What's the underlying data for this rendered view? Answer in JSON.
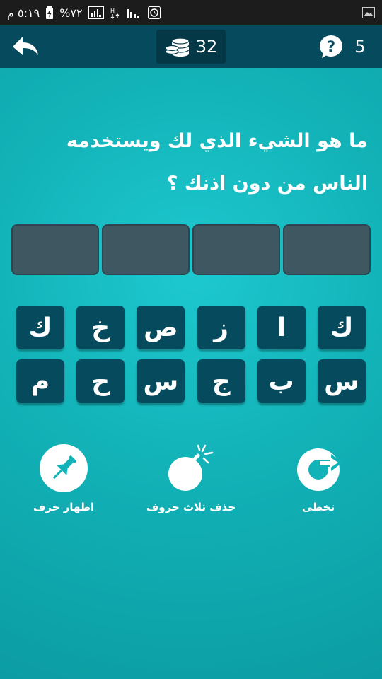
{
  "status_bar": {
    "time": "٥:١٩ م",
    "battery": "%٧٢"
  },
  "top_bar": {
    "coins": "32",
    "level": "5"
  },
  "question": {
    "text": "ما هو الشيء الذي لك ويستخدمه الناس من دون اذنك ؟"
  },
  "answer_slots": 4,
  "letters": {
    "row1": [
      "ك",
      "ا",
      "ز",
      "ص",
      "خ",
      "ك"
    ],
    "row2": [
      "س",
      "ب",
      "ج",
      "س",
      "ح",
      "م"
    ]
  },
  "powerups": {
    "skip_label": "تخطى",
    "remove_label": "حذف ثلاث حروف",
    "reveal_label": "اظهار حرف"
  },
  "colors": {
    "background": "#12b3b8",
    "top_bar": "#064a5e",
    "key": "#064a5e",
    "answer_slot": "#3e5760"
  }
}
